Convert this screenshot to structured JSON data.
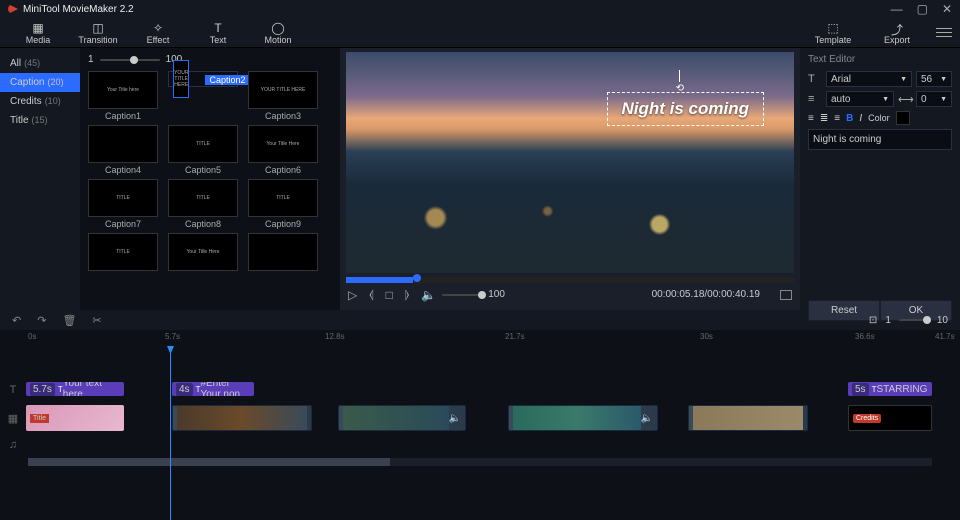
{
  "app": {
    "title": "MiniTool MovieMaker 2.2"
  },
  "tabs": {
    "media": "Media",
    "transition": "Transition",
    "effect": "Effect",
    "text": "Text",
    "motion": "Motion",
    "template": "Template",
    "export": "Export"
  },
  "sidebar": {
    "all": {
      "label": "All",
      "count": "(45)"
    },
    "caption": {
      "label": "Caption",
      "count": "(20)"
    },
    "credits": {
      "label": "Credits",
      "count": "(10)"
    },
    "title": {
      "label": "Title",
      "count": "(15)"
    }
  },
  "slider": {
    "min": "1",
    "max": "100"
  },
  "captions": [
    {
      "name": "Caption1",
      "txt": "Your Title here"
    },
    {
      "name": "Caption2",
      "txt": "YOUR TITLE HERE"
    },
    {
      "name": "Caption3",
      "txt": "YOUR TITLE HERE"
    },
    {
      "name": "Caption4",
      "txt": ""
    },
    {
      "name": "Caption5",
      "txt": "TITLE"
    },
    {
      "name": "Caption6",
      "txt": "Your Title Here"
    },
    {
      "name": "Caption7",
      "txt": "TITLE"
    },
    {
      "name": "Caption8",
      "txt": "TITLE"
    },
    {
      "name": "Caption9",
      "txt": "TITLE"
    },
    {
      "name": "",
      "txt": "TITLE"
    },
    {
      "name": "",
      "txt": "Your Title Here"
    },
    {
      "name": "",
      "txt": ""
    }
  ],
  "preview": {
    "caption": "Night is coming",
    "vol": "100",
    "time": "00:00:05.18/00:00:40.19"
  },
  "editor": {
    "title": "Text Editor",
    "font": "Arial",
    "size": "56",
    "lh": "auto",
    "sp": "0",
    "bold": "B",
    "italic": "I",
    "color": "Color",
    "text": "Night is coming",
    "reset": "Reset",
    "ok": "OK"
  },
  "zoom": {
    "min": "1",
    "max": "10"
  },
  "ruler": {
    "t0": "0s",
    "t1": "5.7s",
    "t2": "12.8s",
    "t3": "21.7s",
    "t4": "30s",
    "t5": "36.6s",
    "t6": "41.7s"
  },
  "clips": {
    "t1badge": "5.7s",
    "t1txt": "Your text here",
    "t2badge": "4s",
    "t2txt": "#Enter Your non",
    "t3badge": "5s",
    "t3txt": "STARRING",
    "cred": "Credits",
    "titlebadge": "Title"
  }
}
